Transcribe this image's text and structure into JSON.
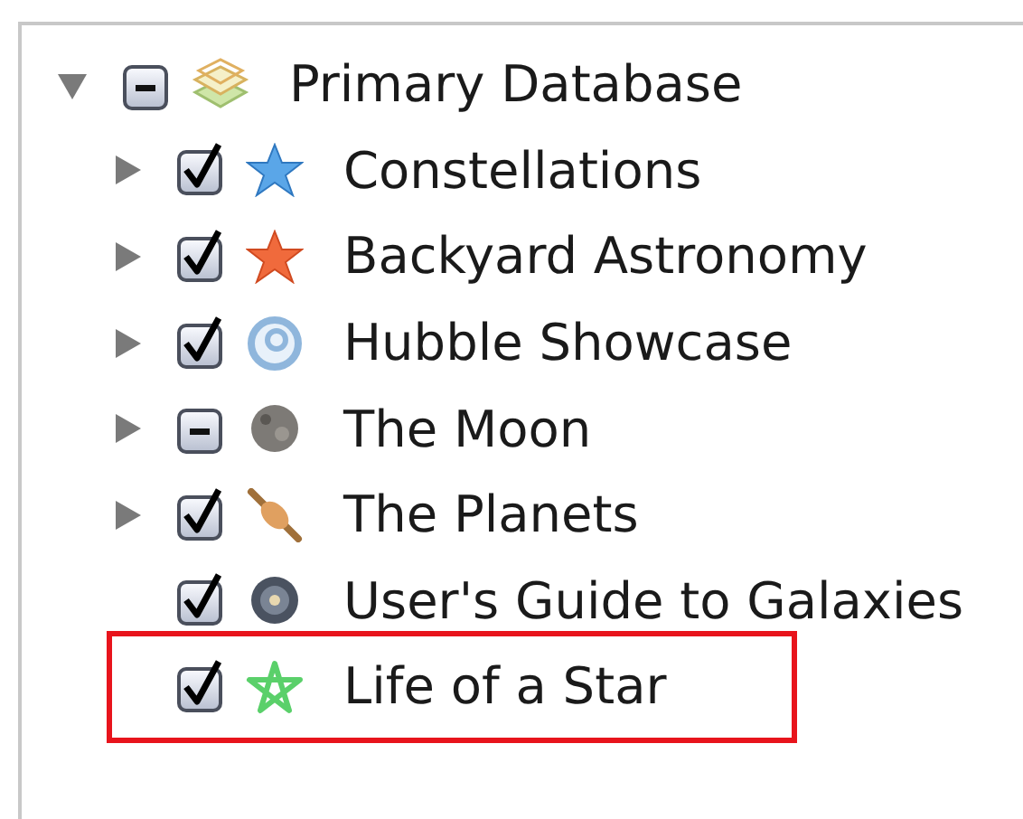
{
  "tree": [
    {
      "label": "Primary Database",
      "checked": false,
      "mixed": true,
      "expanded": true,
      "highlighted": false,
      "children": [
        {
          "label": "Constellations",
          "checked": true,
          "mixed": false,
          "expanded": false,
          "highlighted": false
        },
        {
          "label": "Backyard Astronomy",
          "checked": true,
          "mixed": false,
          "expanded": false,
          "highlighted": false
        },
        {
          "label": "Hubble Showcase",
          "checked": true,
          "mixed": false,
          "expanded": false,
          "highlighted": false
        },
        {
          "label": "The Moon",
          "checked": false,
          "mixed": true,
          "expanded": false,
          "highlighted": false
        },
        {
          "label": "The Planets",
          "checked": true,
          "mixed": false,
          "expanded": false,
          "highlighted": false
        },
        {
          "label": "User's Guide to Galaxies",
          "checked": true,
          "mixed": false,
          "highlighted": false
        },
        {
          "label": "Life of a Star",
          "checked": true,
          "mixed": false,
          "highlighted": true
        }
      ]
    }
  ]
}
